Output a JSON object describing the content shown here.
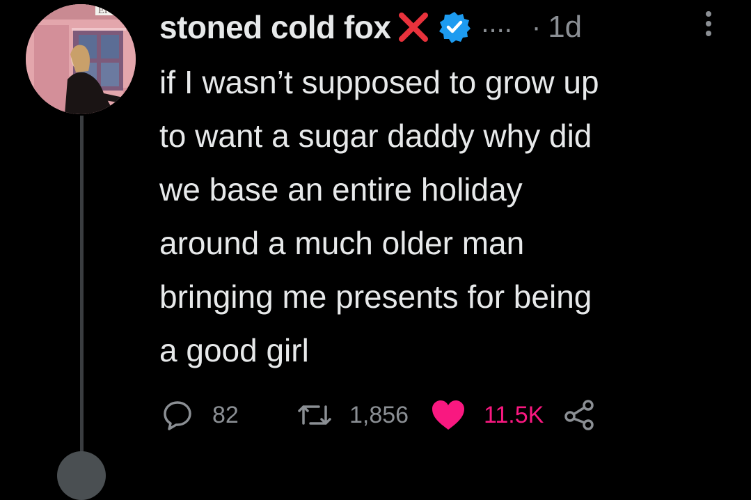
{
  "author": {
    "display_name": "stoned cold fox",
    "name_emoji": "cross-mark",
    "verified": true,
    "truncation": "....",
    "separator": "·",
    "timestamp": "1d",
    "avatar_sign_text": "EPHO"
  },
  "tweet": {
    "text": "if I wasn’t supposed to grow up\nto want a sugar daddy why did\nwe base an entire holiday\naround a much older man\nbringing me presents for being\na good girl"
  },
  "actions": {
    "reply_count": "82",
    "retweet_count": "1,856",
    "like_count": "11.5K",
    "liked": true
  },
  "icons": {
    "reply": "speech-bubble-icon",
    "retweet": "retweet-arrows-icon",
    "like": "heart-icon",
    "share": "share-nodes-icon",
    "more": "vertical-dots-icon"
  },
  "colors": {
    "background": "#000000",
    "text": "#e7e9ea",
    "secondary": "#8b8f94",
    "like": "#f91880",
    "verified": "#1d9bf0",
    "cross": "#e8323c"
  }
}
